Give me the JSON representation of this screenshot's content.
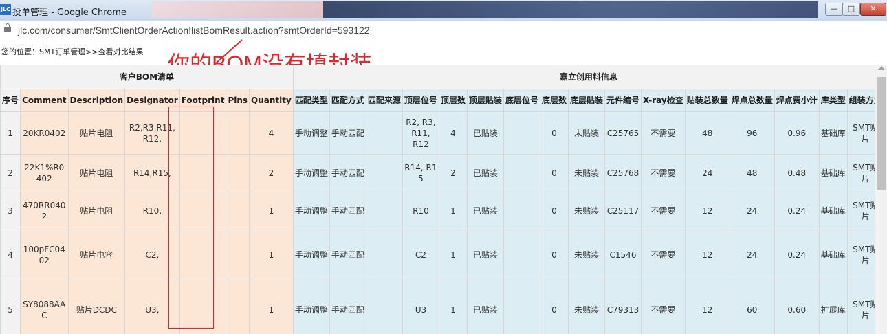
{
  "window": {
    "title": "投单管理 - Google Chrome",
    "icon_text": "JLC",
    "minimize": "—",
    "maximize": "□",
    "close": "✕"
  },
  "address": {
    "url": "jlc.com/consumer/SmtClientOrderAction!listBomResult.action?smtOrderId=593122"
  },
  "breadcrumb": "您的位置：SMT订单管理>>查看对比结果",
  "annotation": "你的BOM没有填封装",
  "groups": {
    "bom": "客户BOM清单",
    "jlc": "嘉立创用料信息"
  },
  "columns": [
    "序号",
    "Comment",
    "Description",
    "Designator",
    "Footprint",
    "Pins",
    "Quantity",
    "匹配类型",
    "匹配方式",
    "匹配来源",
    "顶层位号",
    "顶层数",
    "顶层贴装",
    "底层位号",
    "底层数",
    "底层贴装",
    "元件编号",
    "X-ray检查",
    "贴装总数量",
    "焊点总数量",
    "焊点费小计",
    "库类型",
    "组装方式"
  ],
  "rows": [
    {
      "idx": "1",
      "comment": "20KR0402",
      "desc": "贴片电阻",
      "designator": "R2,R3,R11,\nR12,",
      "footprint": "",
      "pins": "",
      "qty": "4",
      "match_type": "手动调整",
      "match_way": "手动匹配",
      "match_src": "",
      "top_pos": "R2, R3,\nR11, R12",
      "top_cnt": "4",
      "top_mount": "已贴装",
      "bot_pos": "",
      "bot_cnt": "0",
      "bot_mount": "未贴装",
      "part_no": "C25765",
      "xray": "不需要",
      "mount_total": "48",
      "solder_total": "96",
      "solder_fee": "0.96",
      "lib": "基础库",
      "assembly": "SMT贴\n片"
    },
    {
      "idx": "2",
      "comment": "22K1%R0\n402",
      "desc": "贴片电阻",
      "designator": "R14,R15,",
      "footprint": "",
      "pins": "",
      "qty": "2",
      "match_type": "手动调整",
      "match_way": "手动匹配",
      "match_src": "",
      "top_pos": "R14, R1\n5",
      "top_cnt": "2",
      "top_mount": "已贴装",
      "bot_pos": "",
      "bot_cnt": "0",
      "bot_mount": "未贴装",
      "part_no": "C25768",
      "xray": "不需要",
      "mount_total": "24",
      "solder_total": "48",
      "solder_fee": "0.48",
      "lib": "基础库",
      "assembly": "SMT贴\n片"
    },
    {
      "idx": "3",
      "comment": "470RR040\n2",
      "desc": "贴片电阻",
      "designator": "R10,",
      "footprint": "",
      "pins": "",
      "qty": "1",
      "match_type": "手动调整",
      "match_way": "手动匹配",
      "match_src": "",
      "top_pos": "R10",
      "top_cnt": "1",
      "top_mount": "已贴装",
      "bot_pos": "",
      "bot_cnt": "0",
      "bot_mount": "未贴装",
      "part_no": "C25117",
      "xray": "不需要",
      "mount_total": "12",
      "solder_total": "24",
      "solder_fee": "0.24",
      "lib": "基础库",
      "assembly": "SMT贴\n片"
    },
    {
      "idx": "4",
      "comment": "100pFC04\n02",
      "desc": "贴片电容",
      "designator": "C2,",
      "footprint": "",
      "pins": "",
      "qty": "1",
      "match_type": "手动调整",
      "match_way": "手动匹配",
      "match_src": "",
      "top_pos": "C2",
      "top_cnt": "1",
      "top_mount": "已贴装",
      "bot_pos": "",
      "bot_cnt": "0",
      "bot_mount": "未贴装",
      "part_no": "C1546",
      "xray": "不需要",
      "mount_total": "12",
      "solder_total": "24",
      "solder_fee": "0.24",
      "lib": "基础库",
      "assembly": "SMT贴\n片"
    },
    {
      "idx": "5",
      "comment": "SY8088AA\nC",
      "desc": "贴片DCDC",
      "designator": "U3,",
      "footprint": "",
      "pins": "",
      "qty": "1",
      "match_type": "手动调整",
      "match_way": "手动匹配",
      "match_src": "",
      "top_pos": "U3",
      "top_cnt": "1",
      "top_mount": "已贴装",
      "bot_pos": "",
      "bot_cnt": "0",
      "bot_mount": "未贴装",
      "part_no": "C79313",
      "xray": "不需要",
      "mount_total": "12",
      "solder_total": "60",
      "solder_fee": "0.60",
      "lib": "扩展库",
      "assembly": "SMT贴\n片"
    }
  ]
}
